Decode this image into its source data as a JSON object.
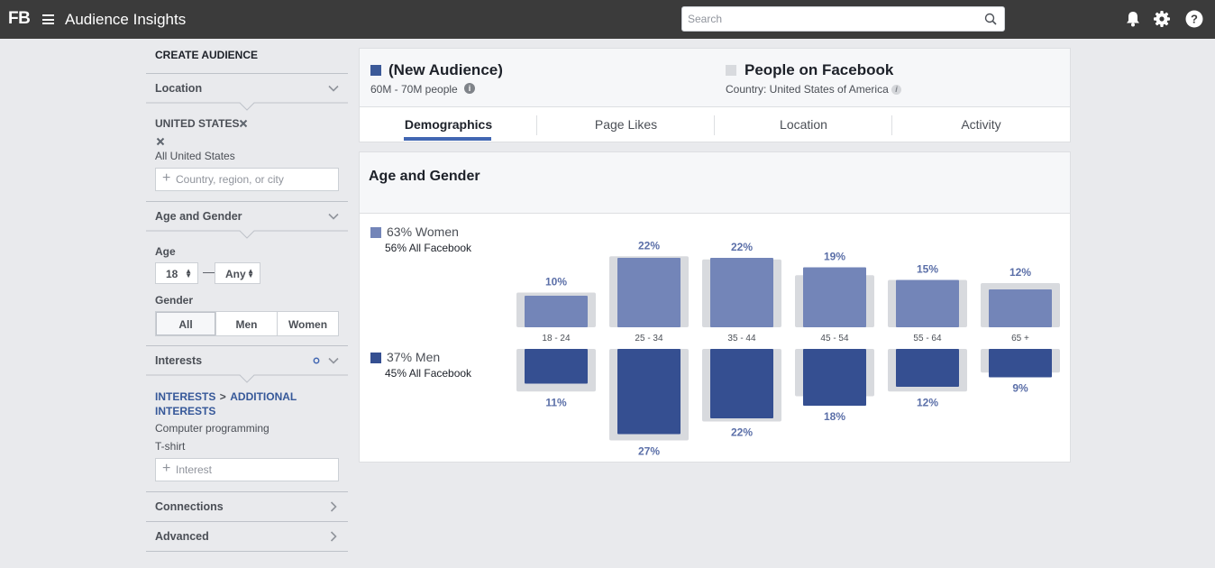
{
  "topbar": {
    "logo": "FB",
    "title": "Audience Insights",
    "search_placeholder": "Search"
  },
  "sidebar": {
    "create_audience": "CREATE AUDIENCE",
    "location": {
      "heading": "Location",
      "country": "UNITED STATES",
      "scope": "All United States",
      "placeholder": "Country, region, or city"
    },
    "age_gender": {
      "heading": "Age and Gender",
      "age_label": "Age",
      "age_min": "18",
      "age_dash": "—",
      "age_max": "Any",
      "gender_label": "Gender",
      "gender_options": [
        "All",
        "Men",
        "Women"
      ],
      "gender_selected": "All"
    },
    "interests": {
      "heading": "Interests",
      "path_root": "INTERESTS",
      "path_sep": ">",
      "path_child": "ADDITIONAL INTERESTS",
      "items": [
        "Computer programming",
        "T-shirt"
      ],
      "placeholder": "Interest"
    },
    "connections": "Connections",
    "advanced": "Advanced"
  },
  "header": {
    "audience": {
      "name": "(New Audience)",
      "size": "60M - 70M people",
      "color": "#3b5998"
    },
    "comparison": {
      "name": "People on Facebook",
      "country": "Country: United States of America",
      "color": "#d8dade"
    },
    "tabs": [
      "Demographics",
      "Page Likes",
      "Location",
      "Activity"
    ],
    "active_tab": "Demographics"
  },
  "age_gender_panel": {
    "title": "Age and Gender",
    "women": {
      "label": "63% Women",
      "sub": "56% All Facebook",
      "color": "#7385b8"
    },
    "men": {
      "label": "37% Men",
      "sub": "45% All Facebook",
      "color": "#354f91"
    },
    "baseline_color": "#d8dade"
  },
  "chart_data": {
    "type": "bar",
    "categories": [
      "18 - 24",
      "25 - 34",
      "35 - 44",
      "45 - 54",
      "55 - 64",
      "65 +"
    ],
    "series": [
      {
        "name": "63% Women",
        "values": [
          10,
          22,
          22,
          19,
          15,
          12
        ],
        "labels": [
          "10%",
          "22%",
          "22%",
          "19%",
          "15%",
          "12%"
        ]
      },
      {
        "name": "37% Men",
        "values": [
          11,
          27,
          22,
          18,
          12,
          9
        ],
        "labels": [
          "11%",
          "27%",
          "22%",
          "18%",
          "12%",
          "9%"
        ]
      }
    ],
    "baseline_women": [
      11,
      22.5,
      21.5,
      16.5,
      15,
      14
    ],
    "baseline_men": [
      13.5,
      29,
      23,
      15,
      13.5,
      7.5
    ]
  }
}
